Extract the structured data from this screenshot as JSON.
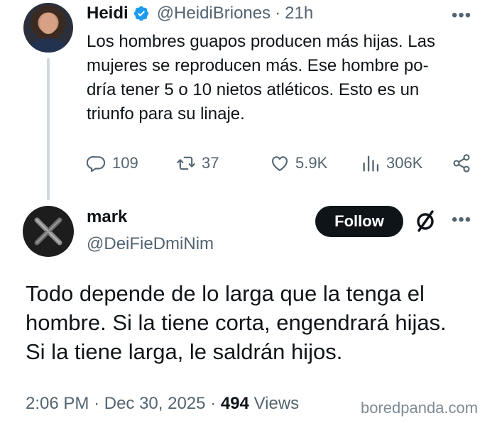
{
  "tweet1": {
    "name": "Heidi",
    "handle": "@HeidiBriones",
    "separator": "·",
    "time": "21h",
    "more": "•••",
    "text_lines": [
      "Los hombres guapos producen más hijas. Las",
      "mujeres se reproducen más. Ese hombre po-",
      "dría tener 5 o 10 nietos atléticos. Esto es un",
      "triunfo para su linaje."
    ],
    "actions": {
      "replies": "109",
      "retweets": "37",
      "likes": "5.9K",
      "views": "306K"
    }
  },
  "tweet2": {
    "name": "mark",
    "handle": "@DeiFieDmiNim",
    "follow_label": "Follow",
    "more": "•••",
    "text_lines": [
      "Todo depende de lo larga que la tenga el",
      "hombre. Si la tiene corta, engendrará hijas.",
      "Si la tiene larga, le saldrán hijos."
    ],
    "time": "2:06 PM",
    "date": "Dec 30, 2025",
    "views_count": "494",
    "views_label": "Views"
  },
  "watermark": "boredpanda.com",
  "colors": {
    "text": "#0f1419",
    "muted": "#536471",
    "verified": "#1d9bf0",
    "thread_line": "#cfd9de"
  },
  "icons": [
    "verified-badge-icon",
    "reply-icon",
    "retweet-icon",
    "like-icon",
    "views-icon",
    "share-icon",
    "grok-icon",
    "more-icon"
  ]
}
